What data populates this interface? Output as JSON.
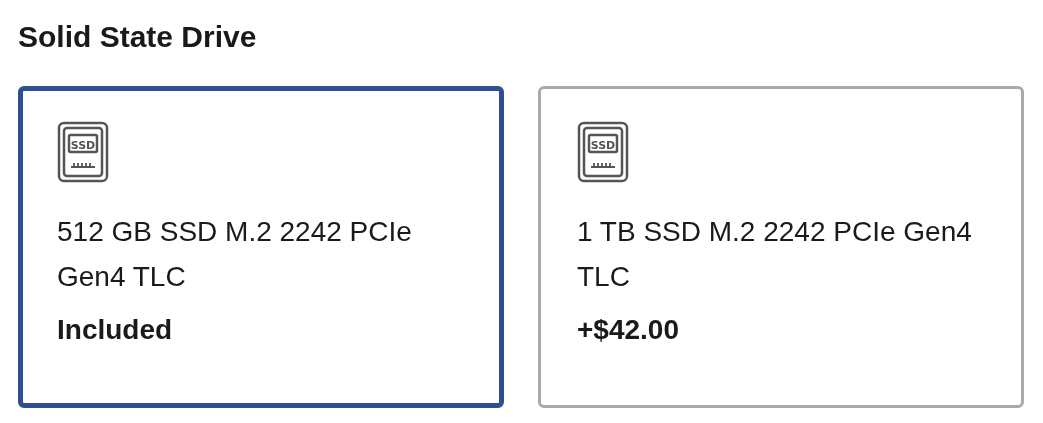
{
  "section_title": "Solid State Drive",
  "options": [
    {
      "icon_label": "SSD",
      "name": "512 GB SSD M.2 2242 PCIe Gen4 TLC",
      "price": "Included",
      "selected": true
    },
    {
      "icon_label": "SSD",
      "name": "1 TB SSD M.2 2242 PCIe Gen4 TLC",
      "price": "+$42.00",
      "selected": false
    }
  ]
}
